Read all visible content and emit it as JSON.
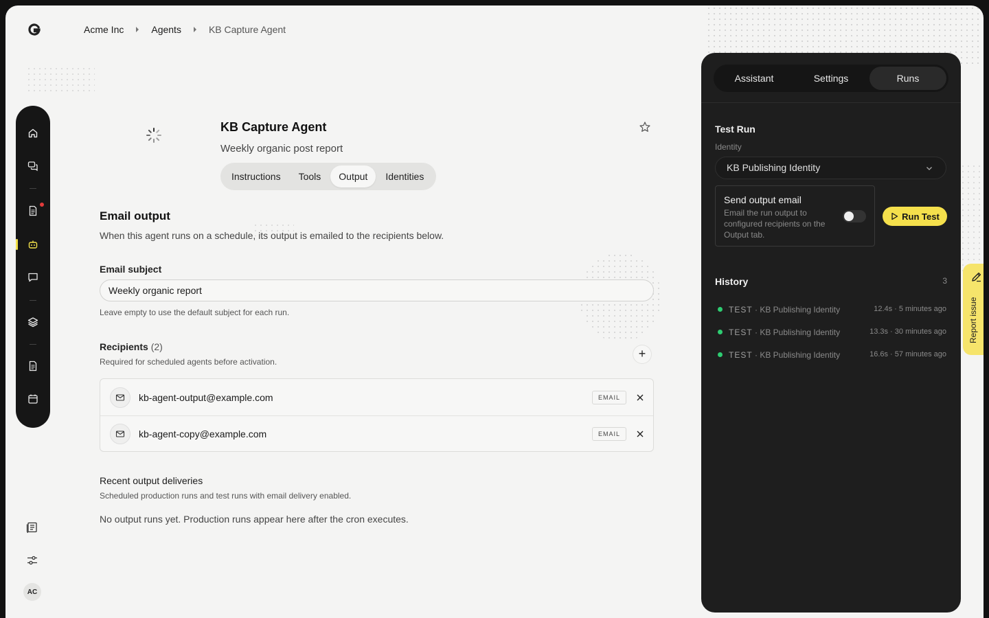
{
  "breadcrumb": {
    "org": "Acme Inc",
    "section": "Agents",
    "current": "KB Capture Agent"
  },
  "rail": {
    "icons": [
      "home-icon",
      "chat-icon",
      "document-icon",
      "bot-icon",
      "message-icon",
      "layers-icon",
      "file-icon",
      "calendar-icon"
    ],
    "active": "bot-icon"
  },
  "footer_nav": {
    "icons": [
      "book-icon",
      "sliders-icon"
    ],
    "avatar_initials": "AC"
  },
  "agent": {
    "name": "KB Capture Agent",
    "subtitle": "Weekly organic post report",
    "tabs": [
      "Instructions",
      "Tools",
      "Output",
      "Identities"
    ],
    "active_tab": "Output"
  },
  "email_output": {
    "heading": "Email output",
    "description": "When this agent runs on a schedule, its output is emailed to the recipients below.",
    "subject_label": "Email subject",
    "subject_value": "Weekly organic report",
    "subject_hint": "Leave empty to use the default subject for each run.",
    "recipients_label": "Recipients",
    "recipients_count": "(2)",
    "recipients_hint": "Required for scheduled agents before activation.",
    "recipients": [
      {
        "address": "kb-agent-output@example.com",
        "tag": "EMAIL"
      },
      {
        "address": "kb-agent-copy@example.com",
        "tag": "EMAIL"
      }
    ],
    "deliveries_heading": "Recent output deliveries",
    "deliveries_description": "Scheduled production runs and test runs with email delivery enabled.",
    "deliveries_empty": "No output runs yet. Production runs appear here after the cron executes."
  },
  "panel": {
    "tabs": [
      "Assistant",
      "Settings",
      "Runs"
    ],
    "active_tab": "Runs",
    "test_run": {
      "heading": "Test Run",
      "identity_label": "Identity",
      "identity_value": "KB Publishing Identity",
      "send_email_title": "Send output email",
      "send_email_desc": "Email the run output to configured recipients on the Output tab.",
      "send_email_on": false,
      "run_button": "Run Test"
    },
    "history": {
      "heading": "History",
      "count": "3",
      "rows": [
        {
          "type": "TEST",
          "identity": "· KB Publishing Identity",
          "meta": "12.4s · 5 minutes ago",
          "status_color": "#2ecc71"
        },
        {
          "type": "TEST",
          "identity": "· KB Publishing Identity",
          "meta": "13.3s · 30 minutes ago",
          "status_color": "#2ecc71"
        },
        {
          "type": "TEST",
          "identity": "· KB Publishing Identity",
          "meta": "16.6s · 57 minutes ago",
          "status_color": "#2ecc71"
        }
      ]
    }
  },
  "report_issue": {
    "label": "Report issue"
  },
  "colors": {
    "accent_yellow": "#f5e04c",
    "panel_bg": "#1e1e1e",
    "rail_bg": "#161616",
    "success_green": "#2ecc71",
    "notification_red": "#e23b3b"
  }
}
